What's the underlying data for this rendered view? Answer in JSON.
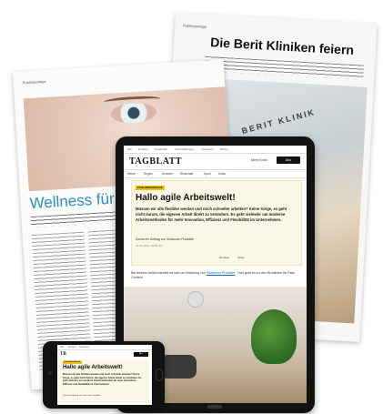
{
  "back_page": {
    "kicker": "Publireportage",
    "headline": "Die Berit Kliniken feiern",
    "building_sign": "BERIT KLINIK"
  },
  "front_page": {
    "kicker": "Publireportage",
    "title": "Wellness für die"
  },
  "tablet": {
    "top_links": [
      "Alle",
      "E-Paper",
      "Newsletter",
      "Veranstaltungen",
      "Podcasts",
      "Wetter"
    ],
    "brand": "TAGBLATT",
    "login_label": "Mein Konto",
    "abo_label": "Abo",
    "nav_items": [
      "Meine",
      "Region",
      "Schweiz",
      "Wirtschaft",
      "Sport",
      "Kultur"
    ],
    "badge": "PUBLIREPORTAGE",
    "headline": "Hallo agile Arbeitswelt!",
    "teaser": "Müssen wir alle flexibler werden und noch schneller arbeiten? Keine Sorge, es geht nicht darum, die eigenen Arbeit direkt zu verändern. Es geht vielmehr um moderne Arbeitsmethoden für mehr Innovation, Effizienz und Flexibilität im Unternehmen.",
    "byline": "Zuerst ein Auftrag von Swisscom Produkte",
    "date": "06.01.2022, 10:00 Uhr",
    "share": [
      "Drucken",
      "Teilen"
    ],
    "disclaimer_pre": "Bei diesem Artikel handelt es sich um Werbung von",
    "disclaimer_link": "Swisscom Produkte",
    "disclaimer_post": ". Hier geht es zu den Richtlinien für Paid Content."
  },
  "phone": {
    "top_links": [
      "Alle",
      "E-Paper",
      "Newsletter"
    ],
    "brand": "TB",
    "abo_label": "Abo",
    "badge": "PUBLIREPORTAGE",
    "headline": "Hallo agile Arbeitswelt!",
    "teaser": "Müssen wir alle flexibler werden und noch schneller arbeiten? Keine Sorge, es geht nicht darum, die eigenen Arbeit direkt zu verändern. Es geht vielmehr um moderne Arbeitsmethoden für mehr Innovation, Effizienz und Flexibilität im Unternehmen.",
    "byline": "Zuerst ein Auftrag von Swisscom Produkte"
  },
  "colors": {
    "accent_blue": "#2b8fc7",
    "badge_yellow": "#f2c200",
    "device_black": "#121212"
  }
}
